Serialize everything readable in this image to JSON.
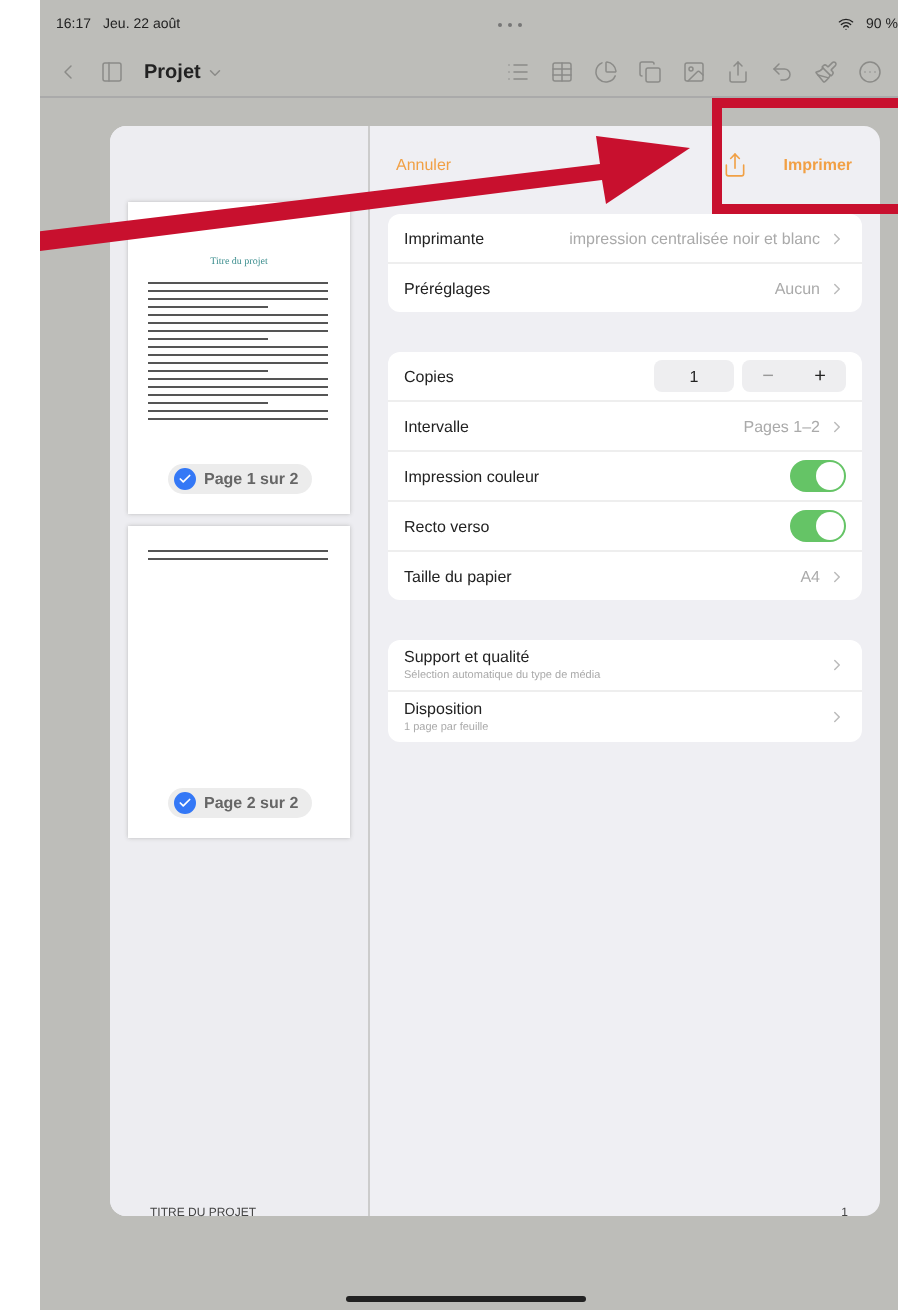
{
  "status_bar": {
    "time": "16:17",
    "date": "Jeu. 22 août",
    "battery": "90 %"
  },
  "toolbar": {
    "title": "Projet"
  },
  "print_dialog": {
    "cancel": "Annuler",
    "print": "Imprimer",
    "pages": [
      {
        "label": "Page 1 sur 2",
        "checked": true,
        "heading": "Titre du projet"
      },
      {
        "label": "Page 2 sur 2",
        "checked": true
      }
    ],
    "groups": [
      [
        {
          "kind": "value",
          "label": "Imprimante",
          "value": "impression centralisée noir et blanc"
        },
        {
          "kind": "value",
          "label": "Préréglages",
          "value": "Aucun"
        }
      ],
      [
        {
          "kind": "stepper",
          "label": "Copies",
          "value": "1",
          "minus": "−",
          "plus": "+"
        },
        {
          "kind": "value",
          "label": "Intervalle",
          "value": "Pages 1–2"
        },
        {
          "kind": "toggle",
          "label": "Impression couleur",
          "on": true
        },
        {
          "kind": "toggle",
          "label": "Recto verso",
          "on": true
        },
        {
          "kind": "value",
          "label": "Taille du papier",
          "value": "A4"
        }
      ],
      [
        {
          "kind": "detail",
          "label": "Support et qualité",
          "sub": "Sélection automatique du type de média"
        },
        {
          "kind": "detail",
          "label": "Disposition",
          "sub": "1 page par feuille"
        }
      ]
    ]
  },
  "document_footer": {
    "title": "TITRE DU PROJET",
    "page": "1"
  }
}
